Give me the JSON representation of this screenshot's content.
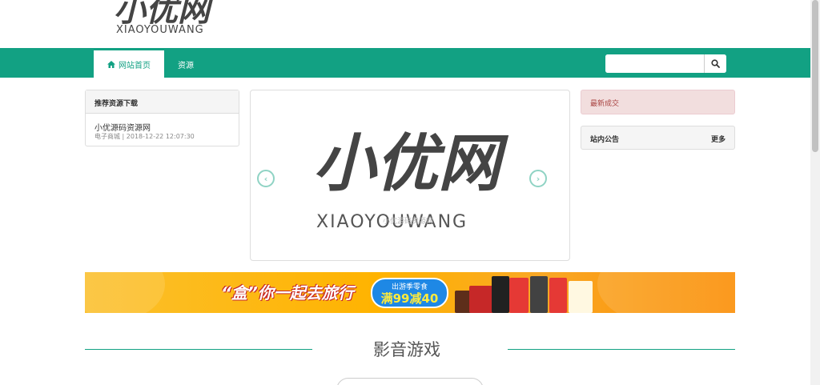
{
  "header": {
    "logo_text": "小优网",
    "logo_sub": "XIAOYOUWANG"
  },
  "nav": {
    "home_label": "网站首页",
    "resource_label": "资源",
    "search_placeholder": ""
  },
  "recommend": {
    "title": "推荐资源下载",
    "items": [
      {
        "title": "小优源码资源网",
        "meta": "电子商城 | 2018-12-22 12:07:30"
      }
    ]
  },
  "carousel": {
    "logo_text": "小优网",
    "logo_sub": "XIAOYOUWANG",
    "watermark": "小优源码资源网"
  },
  "sidebar": {
    "latest_title": "最新成交",
    "notice_title": "站内公告",
    "notice_more": "更多"
  },
  "banner": {
    "slogan": "“盒”你一起去旅行",
    "promo_line1": "出游季零食",
    "promo_line2": "满99减40"
  },
  "section": {
    "title": "影音游戏"
  },
  "colors": {
    "brand": "#12a183",
    "alert_bg": "#f2dede",
    "alert_text": "#a94442"
  }
}
